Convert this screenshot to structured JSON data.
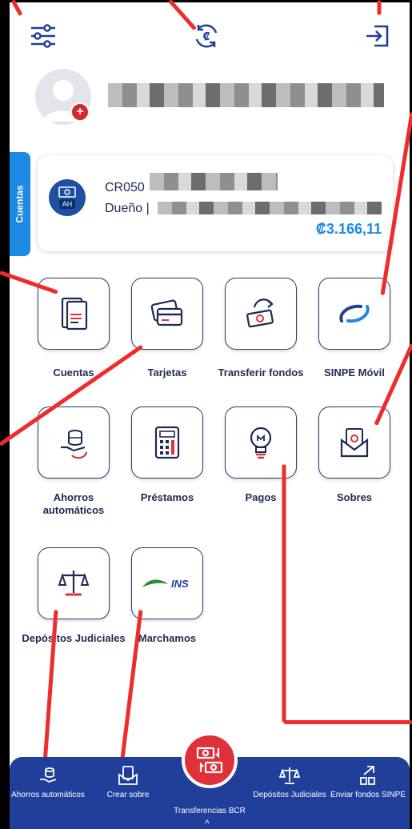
{
  "account": {
    "iban_prefix": "CR050",
    "owner_prefix": "Dueño |",
    "badge": "AH",
    "balance": "₡3.166,11"
  },
  "side_tab": {
    "label": "Cuentas"
  },
  "grid": {
    "items": [
      {
        "label": "Cuentas",
        "icon": "document-icon"
      },
      {
        "label": "Tarjetas",
        "icon": "card-icon"
      },
      {
        "label": "Transferir fondos",
        "icon": "money-transfer-icon"
      },
      {
        "label": "SINPE Móvil",
        "icon": "sinpe-icon"
      },
      {
        "label": "Ahorros automáticos",
        "icon": "savings-icon"
      },
      {
        "label": "Préstamos",
        "icon": "calculator-icon"
      },
      {
        "label": "Pagos",
        "icon": "lightbulb-icon"
      },
      {
        "label": "Sobres",
        "icon": "envelope-icon"
      },
      {
        "label": "Depósitos Judiciales",
        "icon": "scale-icon"
      },
      {
        "label": "Marchamos",
        "icon": "ins-logo"
      }
    ]
  },
  "bottom_nav": {
    "items": [
      {
        "label": "Ahorros automáticos"
      },
      {
        "label": "Crear sobre"
      },
      {
        "label": "Transferencias BCR"
      },
      {
        "label": "Depósitos Judiciales"
      },
      {
        "label": "Enviar fondos SINPE"
      }
    ]
  },
  "logo_text": "INS",
  "colors": {
    "accent": "#1e88e5",
    "navy": "#1f3f9a",
    "red": "#e0313a",
    "annotation": "#ef2c2c"
  }
}
